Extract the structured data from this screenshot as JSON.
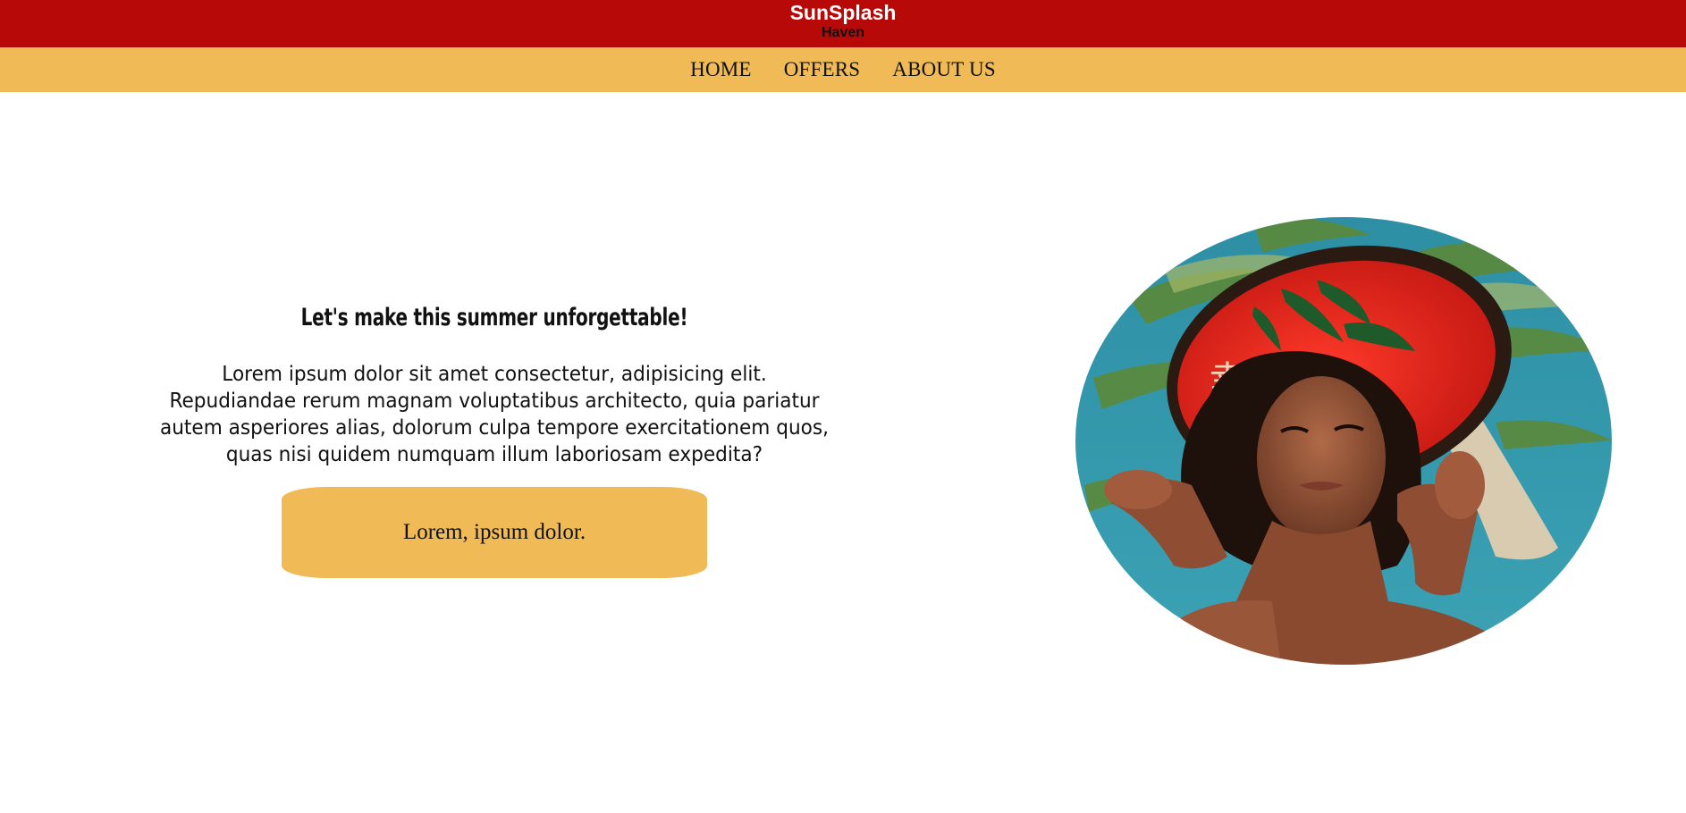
{
  "header": {
    "brand_name": "SunSplash",
    "brand_sub": "Haven",
    "bg_color": "#b70908"
  },
  "nav": {
    "bg_color": "#f0bb57",
    "items": [
      {
        "label": "HOME"
      },
      {
        "label": "OFFERS"
      },
      {
        "label": "ABOUT US"
      }
    ]
  },
  "hero": {
    "title": "Let's make this summer unforgettable!",
    "body_lines": [
      "Lorem ipsum dolor sit amet consectetur, adipisicing elit.",
      "Repudiandae rerum magnam voluptatibus architecto, quia pariatur",
      "autem asperiores alias, dolorum culpa tempore exercitationem quos,",
      "quas nisi quidem numquam illum laboriosam expedita?"
    ],
    "cta_label": "Lorem, ipsum dolor.",
    "image_icon": "woman-in-red-sun-hat-photo"
  }
}
